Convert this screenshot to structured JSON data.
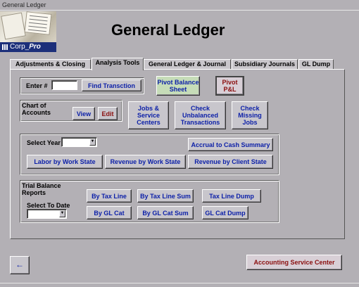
{
  "window": {
    "title": "General Ledger"
  },
  "logo": {
    "brand_prefix": "Corp_",
    "brand_suffix": "Pro"
  },
  "header": {
    "title": "General Ledger"
  },
  "tabs": [
    {
      "label": "Adjustments & Closing",
      "active": false
    },
    {
      "label": "Analysis Tools",
      "active": true
    },
    {
      "label": "General Ledger & Journal",
      "active": false
    },
    {
      "label": "Subsidiary Journals",
      "active": false
    },
    {
      "label": "GL Dump",
      "active": false
    }
  ],
  "find": {
    "label": "Enter #",
    "value": "",
    "button": "Find Transction"
  },
  "pivot": {
    "balance_sheet": "Pivot Balance Sheet",
    "pl": "Pivot P&L"
  },
  "chart_of_accounts": {
    "label": "Chart of Accounts",
    "view": "View",
    "edit": "Edit"
  },
  "tools": {
    "jobs_service_centers": "Jobs & Service Centers",
    "check_unbalanced": "Check Unbalanced Transactions",
    "check_missing_jobs": "Check Missing Jobs"
  },
  "year_section": {
    "select_year_label": "Select Year",
    "select_year_value": "",
    "accrual_to_cash": "Accrual to Cash Summary",
    "labor_by_work_state": "Labor by Work State",
    "revenue_by_work_state": "Revenue by Work State",
    "revenue_by_client_state": "Revenue by Client State"
  },
  "trial_balance": {
    "label": "Trial Balance Reports",
    "select_to_date_label": "Select To Date",
    "select_to_date_value": "",
    "by_tax_line": "By Tax Line",
    "by_tax_line_sum": "By Tax Line Sum",
    "tax_line_dump": "Tax Line Dump",
    "by_gl_cat": "By GL Cat",
    "by_gl_cat_sum": "By GL Cat Sum",
    "gl_cat_dump": "GL Cat Dump"
  },
  "footer": {
    "back_icon_glyph": "←",
    "accounting_service_center": "Accounting Service Center"
  }
}
